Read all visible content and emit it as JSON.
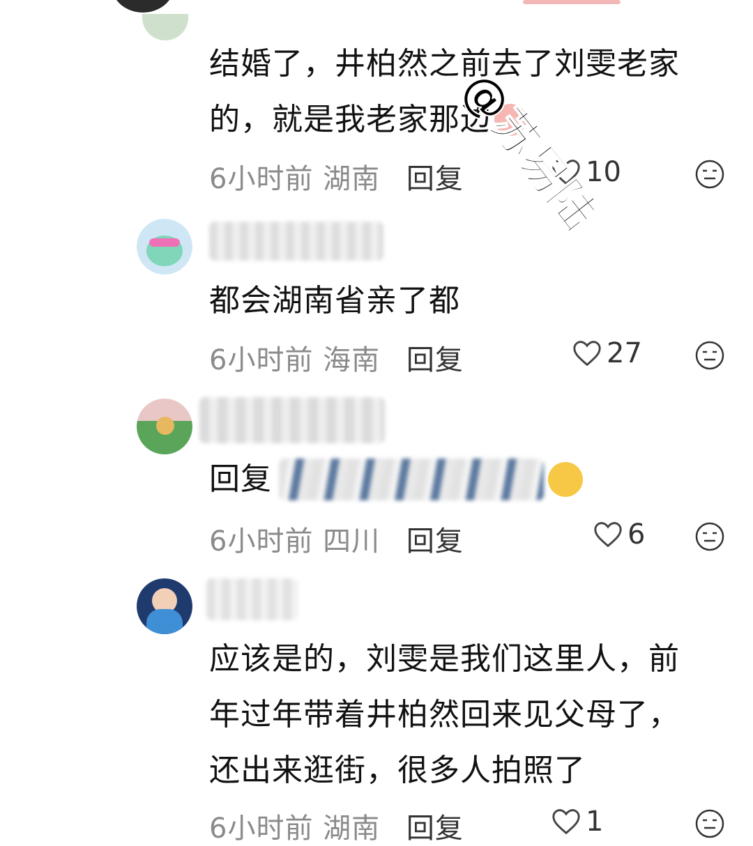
{
  "comments": [
    {
      "text_lines": [
        "结婚了，井柏然之前去了刘雯老家",
        "的，就是我老家那边"
      ],
      "time": "6小时前",
      "location": "湖南",
      "reply": "回复",
      "likes": "10"
    },
    {
      "text_lines": [
        "都会湖南省亲了都"
      ],
      "time": "6小时前",
      "location": "海南",
      "reply": "回复",
      "likes": "27"
    },
    {
      "text_lines": [
        "回复"
      ],
      "time": "6小时前",
      "location": "四川",
      "reply": "回复",
      "likes": "6"
    },
    {
      "text_lines": [
        "应该是的，刘雯是我们这里人，前",
        "年过年带着井柏然回来见父母了，",
        "还出来逛街，很多人拍照了"
      ],
      "time": "6小时前",
      "location": "湖南",
      "reply": "回复",
      "likes": "1"
    }
  ],
  "watermark": "@苏易陆",
  "icons": {
    "like": "heart-outline-icon",
    "dislike": "neutral-face-icon",
    "emoji_sweat": "sleepy-face-emoji",
    "emoji_peach": "peach-emoji"
  },
  "colors": {
    "meta": "#8a8a8a",
    "text": "#111111"
  }
}
